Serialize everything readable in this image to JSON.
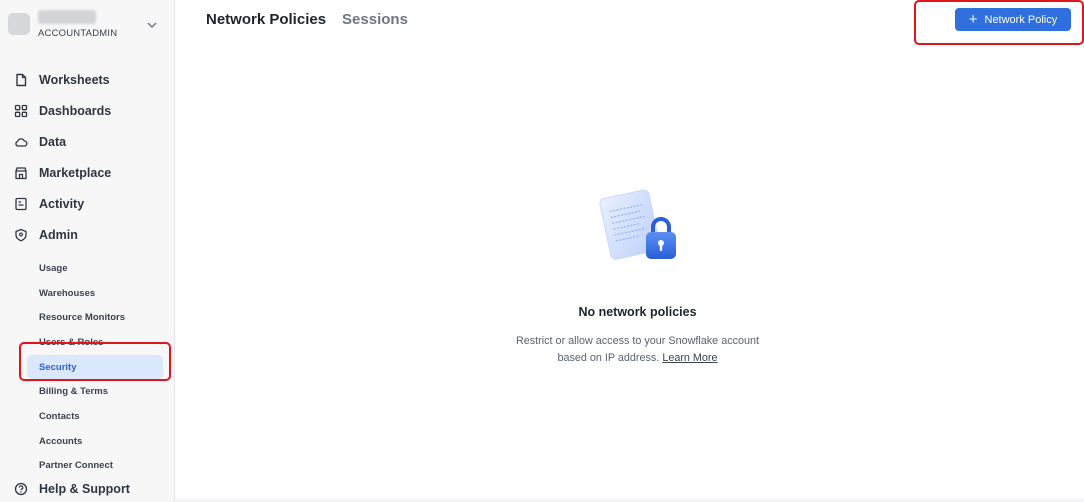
{
  "account": {
    "role": "ACCOUNTADMIN"
  },
  "sidebar": {
    "items": [
      {
        "label": "Worksheets",
        "icon": "file-icon"
      },
      {
        "label": "Dashboards",
        "icon": "grid-icon"
      },
      {
        "label": "Data",
        "icon": "cloud-icon"
      },
      {
        "label": "Marketplace",
        "icon": "store-icon"
      },
      {
        "label": "Activity",
        "icon": "activity-icon"
      },
      {
        "label": "Admin",
        "icon": "shield-icon"
      }
    ],
    "admin_sub": [
      {
        "label": "Usage"
      },
      {
        "label": "Warehouses"
      },
      {
        "label": "Resource Monitors"
      },
      {
        "label": "Users & Roles"
      },
      {
        "label": "Security",
        "active": true
      },
      {
        "label": "Billing & Terms"
      },
      {
        "label": "Contacts"
      },
      {
        "label": "Accounts"
      },
      {
        "label": "Partner Connect"
      }
    ],
    "help": {
      "label": "Help & Support",
      "icon": "help-icon"
    }
  },
  "header": {
    "tabs": [
      {
        "label": "Network Policies",
        "active": true
      },
      {
        "label": "Sessions",
        "active": false
      }
    ],
    "add_button": "Network Policy"
  },
  "empty_state": {
    "title": "No network policies",
    "description": "Restrict or allow access to your Snowflake account based on IP address.",
    "link": "Learn More"
  },
  "colors": {
    "accent": "#2f6fde",
    "highlight": "#e2141b",
    "active_bg": "#dbe7fd"
  }
}
